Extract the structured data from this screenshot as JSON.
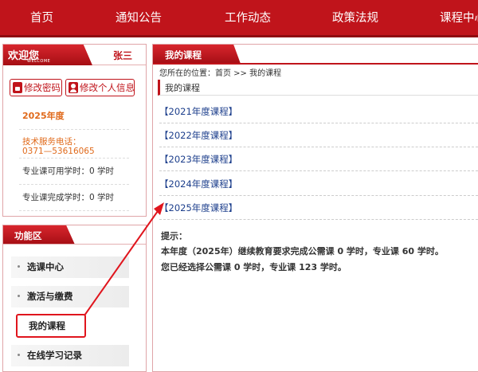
{
  "nav": {
    "items": [
      "首页",
      "通知公告",
      "工作动态",
      "政策法规",
      "课程中心"
    ]
  },
  "welcome": {
    "title": "欢迎您",
    "subtitle": "WELCOME",
    "username": "张三"
  },
  "account_buttons": {
    "change_password": "修改密码",
    "edit_profile": "修改个人信息"
  },
  "profile": {
    "year": "2025年度",
    "support_label": "技术服务电话：",
    "support_phone": "0371—53616065",
    "available_hours": "专业课可用学时：0 学时",
    "completed_hours": "专业课完成学时：0 学时"
  },
  "function_panel": {
    "title": "功能区",
    "items": [
      "选课中心",
      "激活与缴费",
      "我的课程",
      "在线学习记录"
    ]
  },
  "main": {
    "title": "我的课程",
    "breadcrumb": "您所在的位置：首页 >> 我的课程",
    "section_heading": "我的课程",
    "courses": [
      "【2021年度课程】",
      "【2022年度课程】",
      "【2023年度课程】",
      "【2024年度课程】",
      "【2025年度课程】"
    ],
    "tip_label": "提示：",
    "tip_line1": "本年度（2025年）继续教育要求完成公需课 0 学时，专业课 60 学时。",
    "tip_line2": "您已经选择公需课 0 学时，专业课 123 学时。"
  },
  "colors": {
    "brand_red": "#c0141b",
    "accent_orange": "#e06a1b",
    "link_blue": "#1d3f8c"
  }
}
